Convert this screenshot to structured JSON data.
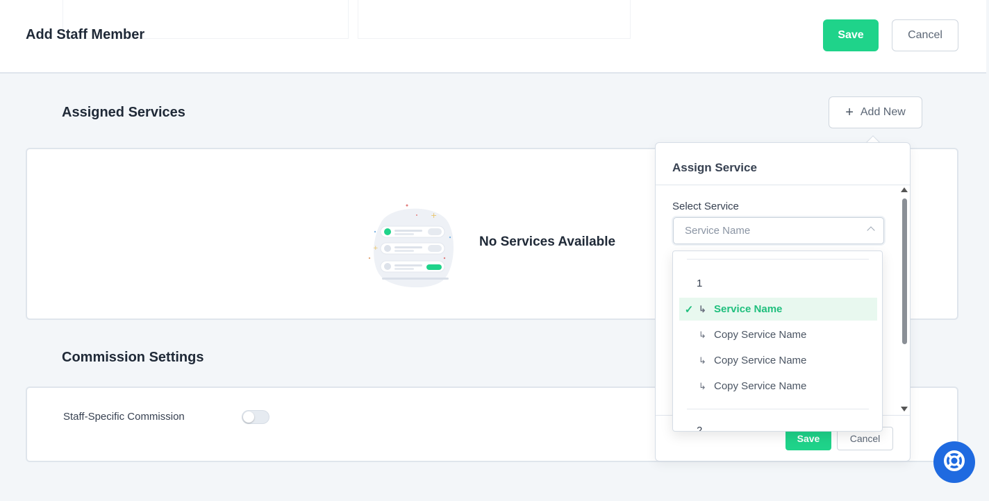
{
  "header": {
    "title": "Add Staff Member",
    "save_label": "Save",
    "cancel_label": "Cancel"
  },
  "assigned_services": {
    "title": "Assigned Services",
    "add_new_label": "Add New",
    "empty_text": "No Services Available"
  },
  "commission": {
    "title": "Commission Settings",
    "staff_specific_label": "Staff-Specific Commission",
    "toggle_on": false
  },
  "assign_popover": {
    "title": "Assign Service",
    "select_label": "Select Service",
    "select_placeholder": "Service Name",
    "save_label": "Save",
    "cancel_label": "Cancel",
    "dropdown": {
      "group_label": "1",
      "items": [
        {
          "label": "Service Name",
          "selected": true
        },
        {
          "label": "Copy Service Name",
          "selected": false
        },
        {
          "label": "Copy Service Name",
          "selected": false
        },
        {
          "label": "Copy Service Name",
          "selected": false
        }
      ],
      "next_group_partial": "2"
    }
  },
  "colors": {
    "accent": "#1fd38a",
    "help": "#1f6ae0"
  },
  "icons": {
    "add": "plus-icon",
    "select_chevron": "chevron-up-icon",
    "check": "check-icon",
    "branch": "subdirectory-arrow-icon",
    "help": "lifebuoy-icon"
  }
}
